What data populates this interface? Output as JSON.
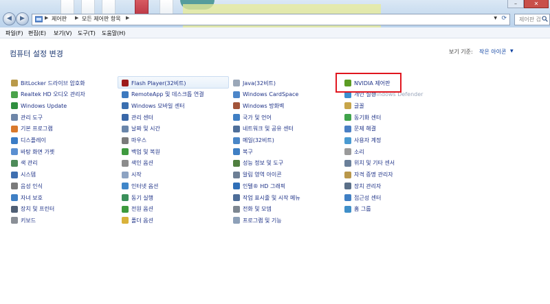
{
  "addressbar": {
    "crumbs": [
      "제어판",
      "모든 제어판 항목"
    ]
  },
  "search": {
    "placeholder": "제어판 검"
  },
  "window_controls": {
    "minimize": "–",
    "close": "✕"
  },
  "menu": [
    "파일(F)",
    "편집(E)",
    "보기(V)",
    "도구(T)",
    "도움말(H)"
  ],
  "page": {
    "title": "컴퓨터 설정 변경",
    "view_by_label": "보기 기준:",
    "view_by_value": "작은 아이콘"
  },
  "columns": [
    [
      {
        "label": "BitLocker 드라이브 암호화",
        "icon": "bitlocker-icon",
        "color": "#b99a4a"
      },
      {
        "label": "Realtek HD 오디오 관리자",
        "icon": "speaker-icon",
        "color": "#4aa34a"
      },
      {
        "label": "Windows Update",
        "icon": "windows-update-icon",
        "color": "#2f8f3f"
      },
      {
        "label": "관리 도구",
        "icon": "admin-tools-icon",
        "color": "#6e86a8"
      },
      {
        "label": "기본 프로그램",
        "icon": "default-programs-icon",
        "color": "#d9792b"
      },
      {
        "label": "디스플레이",
        "icon": "display-icon",
        "color": "#3a7cc6"
      },
      {
        "label": "바탕 화면 가젯",
        "icon": "gadgets-icon",
        "color": "#5a8fd1"
      },
      {
        "label": "색 관리",
        "icon": "color-management-icon",
        "color": "#4e8b5a"
      },
      {
        "label": "시스템",
        "icon": "system-icon",
        "color": "#3f6fb0"
      },
      {
        "label": "음성 인식",
        "icon": "microphone-icon",
        "color": "#7a7a7a"
      },
      {
        "label": "자녀 보호",
        "icon": "parental-controls-icon",
        "color": "#3f7fc4"
      },
      {
        "label": "장치 및 프린터",
        "icon": "printer-icon",
        "color": "#4f5f74"
      },
      {
        "label": "키보드",
        "icon": "keyboard-icon",
        "color": "#8a8f96"
      }
    ],
    [
      {
        "label": "Flash Player(32비트)",
        "icon": "flash-icon",
        "color": "#9c1b1b"
      },
      {
        "label": "RemoteApp 및 데스크톱 연결",
        "icon": "remoteapp-icon",
        "color": "#3c79bf"
      },
      {
        "label": "Windows 모바일 센터",
        "icon": "mobility-center-icon",
        "color": "#3a6fb0"
      },
      {
        "label": "관리 센터",
        "icon": "action-center-icon",
        "color": "#3967a8"
      },
      {
        "label": "날짜 및 시간",
        "icon": "clock-icon",
        "color": "#6a86aa"
      },
      {
        "label": "마우스",
        "icon": "mouse-icon",
        "color": "#7b7b7b"
      },
      {
        "label": "백업 및 복원",
        "icon": "backup-icon",
        "color": "#3f9a3f"
      },
      {
        "label": "색인 옵션",
        "icon": "indexing-icon",
        "color": "#8c8c8c"
      },
      {
        "label": "시작",
        "icon": "getting-started-icon",
        "color": "#8da3c2"
      },
      {
        "label": "인터넷 옵션",
        "icon": "internet-options-icon",
        "color": "#3f86c9"
      },
      {
        "label": "동기 실행",
        "icon": "autoplay-icon",
        "color": "#3a8f5a"
      },
      {
        "label": "전원 옵션",
        "icon": "power-options-icon",
        "color": "#3d9a3d"
      },
      {
        "label": "폴더 옵션",
        "icon": "folder-options-icon",
        "color": "#d9b23a"
      }
    ],
    [
      {
        "label": "Java(32비트)",
        "icon": "java-icon",
        "color": "#9aa7b8"
      },
      {
        "label": "Windows CardSpace",
        "icon": "cardspace-icon",
        "color": "#4c86c9"
      },
      {
        "label": "Windows 방화벽",
        "icon": "firewall-icon",
        "color": "#a2543a"
      },
      {
        "label": "국가 및 언어",
        "icon": "region-language-icon",
        "color": "#3f7fc4"
      },
      {
        "label": "네트워크 및 공유 센터",
        "icon": "network-icon",
        "color": "#4f6f9a"
      },
      {
        "label": "메일(32비트)",
        "icon": "mail-icon",
        "color": "#4a86c7"
      },
      {
        "label": "복구",
        "icon": "recovery-icon",
        "color": "#3f7fc4"
      },
      {
        "label": "성능 정보 및 도구",
        "icon": "performance-icon",
        "color": "#4f7f3f"
      },
      {
        "label": "알림 영역 아이콘",
        "icon": "notification-icon",
        "color": "#6d7f95"
      },
      {
        "label": "인텔® HD 그래픽",
        "icon": "intel-graphics-icon",
        "color": "#2f6fb8"
      },
      {
        "label": "작업 표시줄 및 시작 메뉴",
        "icon": "taskbar-icon",
        "color": "#4d6d98"
      },
      {
        "label": "전화 및 모뎀",
        "icon": "phone-modem-icon",
        "color": "#7e8791"
      },
      {
        "label": "프로그램 및 기능",
        "icon": "programs-features-icon",
        "color": "#8da0b8"
      }
    ],
    [
      {
        "label": "NVIDIA 제어판",
        "icon": "nvidia-icon",
        "color": "#5b9c23"
      },
      {
        "label": "개인 설정",
        "icon": "personalization-icon",
        "color": "#3a8fcf"
      },
      {
        "label": "글꼴",
        "icon": "fonts-icon",
        "color": "#c7a54a"
      },
      {
        "label": "동기화 센터",
        "icon": "sync-center-icon",
        "color": "#3fa34a"
      },
      {
        "label": "문제 해결",
        "icon": "troubleshooting-icon",
        "color": "#4a7fc4"
      },
      {
        "label": "사용자 계정",
        "icon": "user-accounts-icon",
        "color": "#4a9ad1"
      },
      {
        "label": "소리",
        "icon": "sound-icon",
        "color": "#9a9a9a"
      },
      {
        "label": "위치 및 기타 센서",
        "icon": "location-sensors-icon",
        "color": "#6a7f99"
      },
      {
        "label": "자격 증명 관리자",
        "icon": "credential-manager-icon",
        "color": "#b9974a"
      },
      {
        "label": "장치 관리자",
        "icon": "device-manager-icon",
        "color": "#5a6f88"
      },
      {
        "label": "접근성 센터",
        "icon": "ease-of-access-icon",
        "color": "#3f7fc4"
      },
      {
        "label": "홈 그룹",
        "icon": "homegroup-icon",
        "color": "#3f8fc9"
      }
    ]
  ],
  "overlap_text": "Windows Defender"
}
